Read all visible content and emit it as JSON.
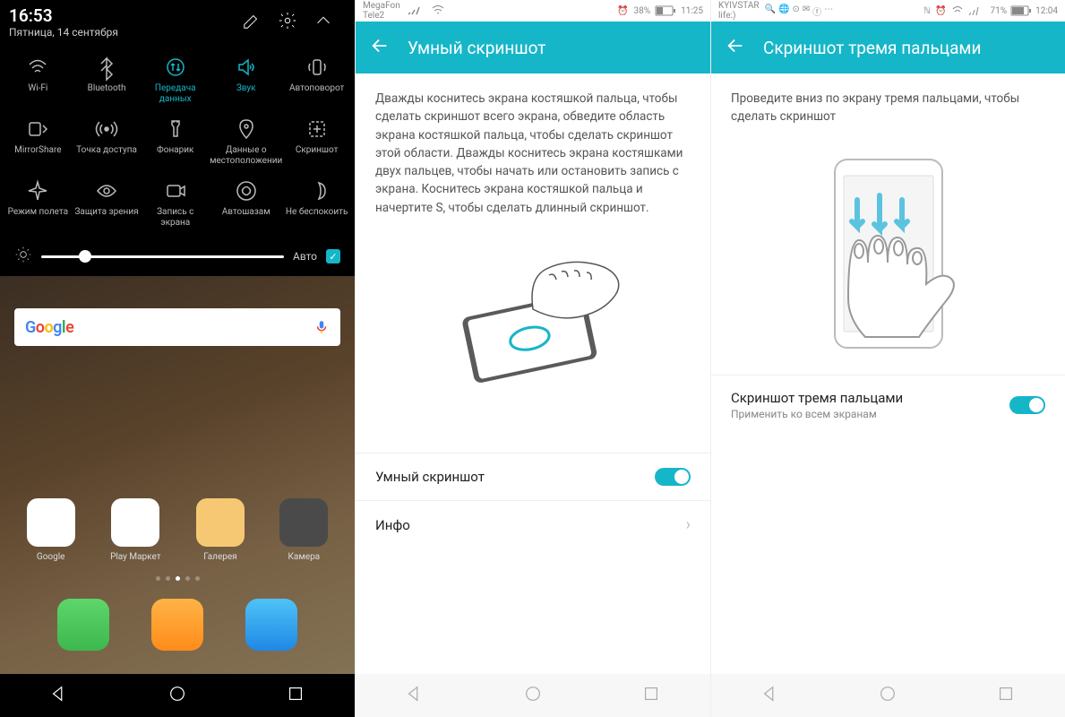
{
  "phone1": {
    "time": "16:53",
    "date": "Пятница, 14 сентября",
    "tiles": [
      {
        "label": "Wi-Fi",
        "icon": "wifi",
        "active": false
      },
      {
        "label": "Bluetooth",
        "icon": "bluetooth",
        "active": false
      },
      {
        "label": "Передача данных",
        "icon": "data",
        "active": true
      },
      {
        "label": "Звук",
        "icon": "sound",
        "active": true
      },
      {
        "label": "Автоповорот",
        "icon": "rotate",
        "active": false
      },
      {
        "label": "MirrorShare",
        "icon": "mirror",
        "active": false
      },
      {
        "label": "Точка доступа",
        "icon": "hotspot",
        "active": false
      },
      {
        "label": "Фонарик",
        "icon": "flashlight",
        "active": false
      },
      {
        "label": "Данные о местоположении",
        "icon": "location",
        "active": false
      },
      {
        "label": "Скриншот",
        "icon": "screenshot",
        "active": false
      },
      {
        "label": "Режим полета",
        "icon": "airplane",
        "active": false
      },
      {
        "label": "Защита зрения",
        "icon": "eye",
        "active": false
      },
      {
        "label": "Запись с экрана",
        "icon": "record",
        "active": false
      },
      {
        "label": "Автошазам",
        "icon": "shazam",
        "active": false
      },
      {
        "label": "Не беспокоить",
        "icon": "dnd",
        "active": false
      }
    ],
    "brightness_auto": "Авто",
    "apps": [
      {
        "label": "Google"
      },
      {
        "label": "Play Маркет"
      },
      {
        "label": "Галерея"
      },
      {
        "label": "Камера"
      }
    ]
  },
  "phone2": {
    "carrier1": "MegaFon",
    "carrier2": "Tele2",
    "battery": "38%",
    "clock_icon": "⏰",
    "time": "11:25",
    "title": "Умный скриншот",
    "description": "Дважды коснитесь экрана костяшкой пальца, чтобы сделать скриншот всего экрана, обведите область экрана костяшкой пальца, чтобы сделать скриншот этой области. Дважды коснитесь экрана костяшками двух пальцев, чтобы начать или остановить запись с экрана. Коснитесь экрана костяшкой пальца и начертите S, чтобы сделать длинный скриншот.",
    "row1": "Умный скриншот",
    "row2": "Инфо"
  },
  "phone3": {
    "carrier": "KYIVSTAR",
    "carrier2": "life:)",
    "battery": "71%",
    "time": "12:04",
    "title": "Скриншот тремя пальцами",
    "description": "Проведите вниз по экрану тремя пальцами, чтобы сделать скриншот",
    "row1_title": "Скриншот тремя пальцами",
    "row1_sub": "Применить ко всем экранам"
  }
}
